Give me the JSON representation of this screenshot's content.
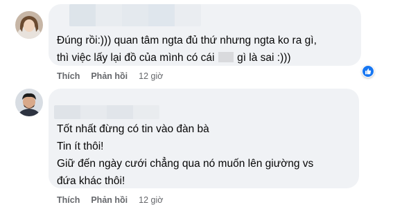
{
  "comments": [
    {
      "text_lines": [
        "Đúng rồi:))) quan tâm ngta đủ thứ nhưng ngta ko ra gì,",
        "thì việc lấy lại đồ của mình có cái",
        "gì là sai :)))"
      ],
      "actions": {
        "like": "Thích",
        "reply": "Phản hồi",
        "time": "12 giờ"
      },
      "reaction_icon": "like-icon"
    },
    {
      "text_lines": [
        "Tốt nhất đừng có tin vào đàn bà",
        "Tin ít thôi!",
        "Giữ đến ngày cưới chẳng qua nó muốn lên giường vs",
        "đứa khác thôi!"
      ],
      "actions": {
        "like": "Thích",
        "reply": "Phản hồi",
        "time": "12 giờ"
      }
    }
  ],
  "colors": {
    "bubble": "#f0f2f5",
    "action_text": "#65676b",
    "like_blue": "#1877f2"
  }
}
